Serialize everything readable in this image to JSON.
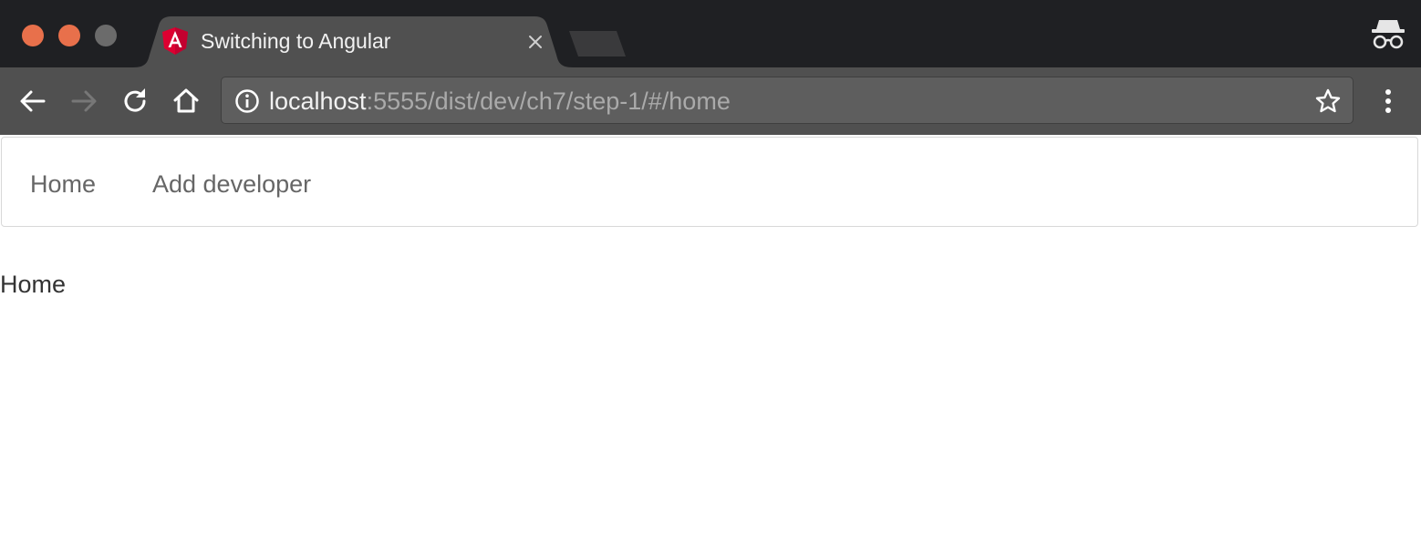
{
  "window": {
    "traffic_lights": {
      "close": "#e8704b",
      "minimize": "#e8704b",
      "maximize": "#6b6b6b"
    }
  },
  "tab": {
    "title": "Switching to Angular",
    "favicon": "angular-logo-icon",
    "close_icon": "close-icon"
  },
  "toolbar": {
    "back_icon": "arrow-left-icon",
    "forward_icon": "arrow-right-icon",
    "reload_icon": "reload-icon",
    "home_icon": "home-icon",
    "menu_icon": "kebab-menu-icon"
  },
  "omnibox": {
    "url_host": "localhost",
    "url_rest": ":5555/dist/dev/ch7/step-1/#/home",
    "info_icon": "info-icon",
    "bookmark_icon": "star-icon"
  },
  "navbar": {
    "links": [
      {
        "label": "Home"
      },
      {
        "label": "Add developer"
      }
    ]
  },
  "page": {
    "heading": "Home"
  },
  "colors": {
    "tabstrip": "#1f2023",
    "toolbar": "#505050",
    "active_tab": "#505050",
    "angular_red": "#dd0031",
    "angular_dark": "#c3002f"
  }
}
